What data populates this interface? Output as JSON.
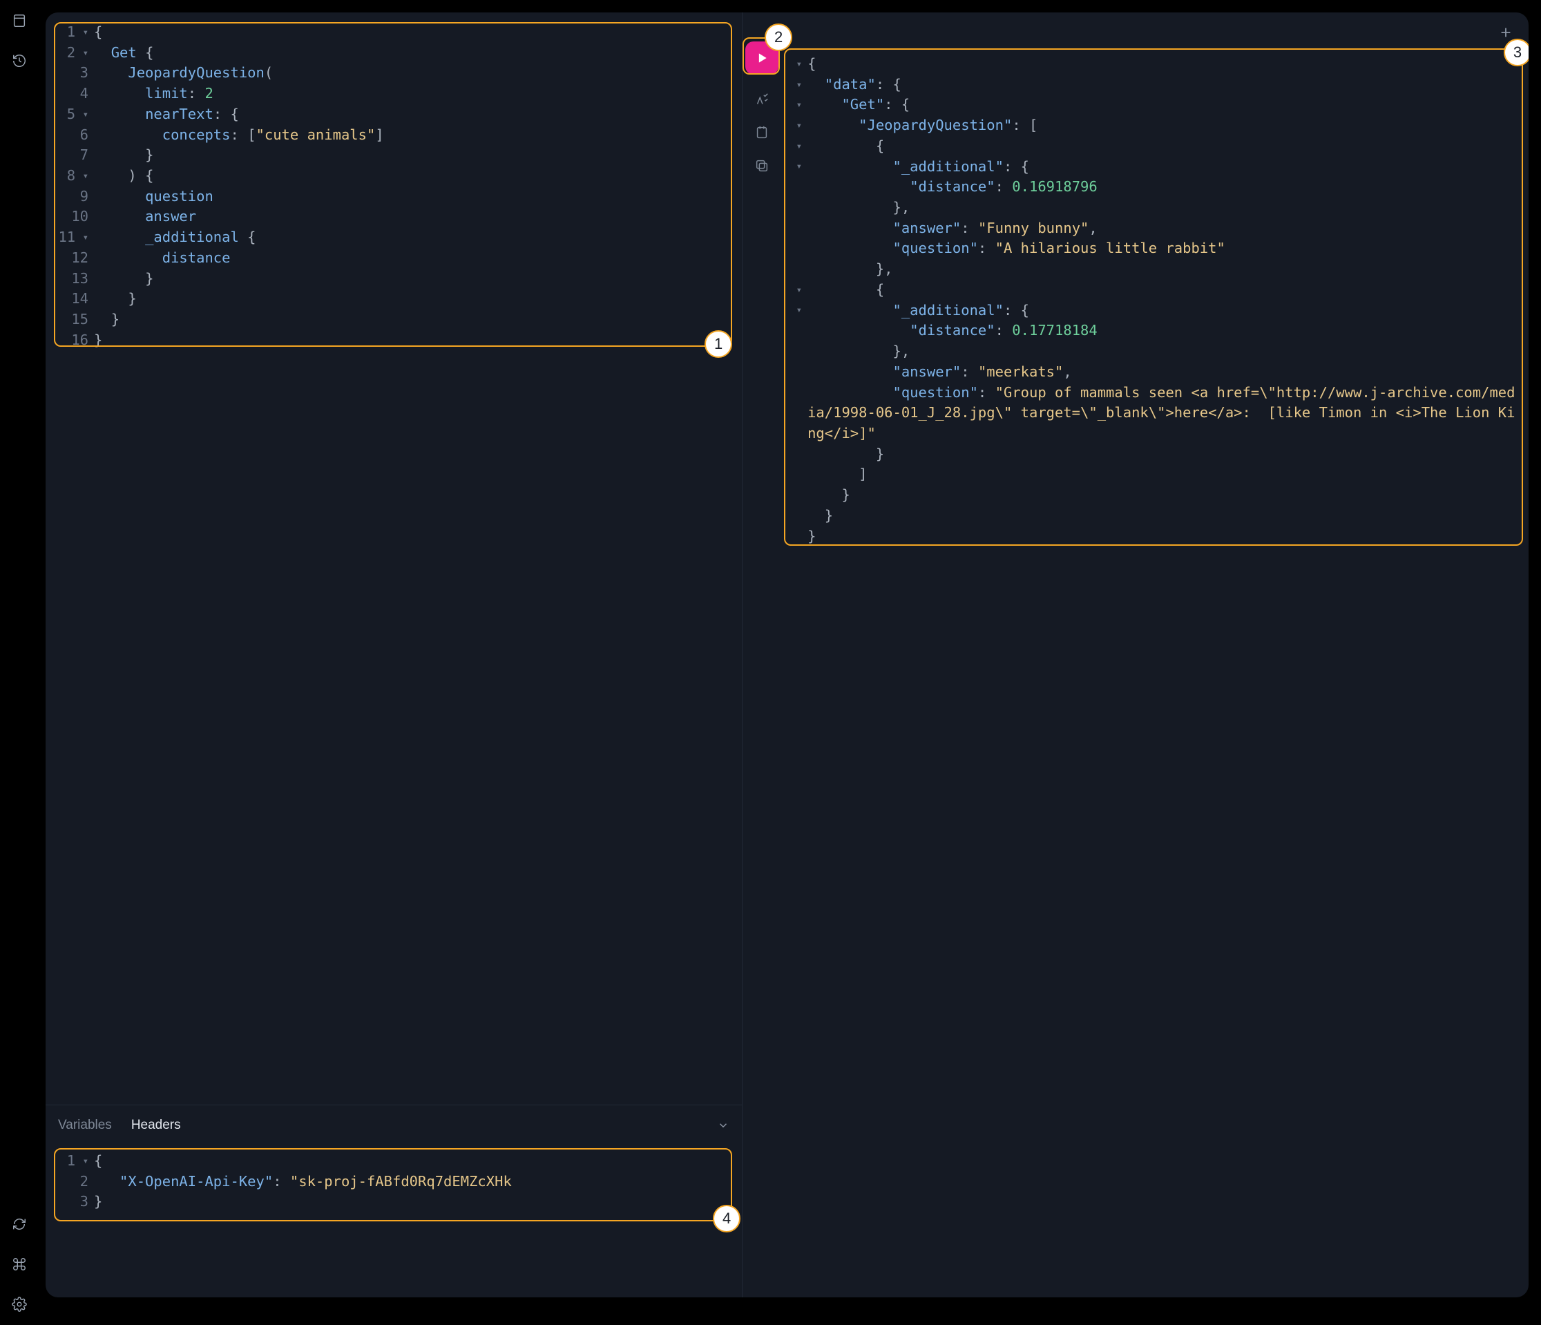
{
  "callouts": {
    "c1": "1",
    "c2": "2",
    "c3": "3",
    "c4": "4"
  },
  "tabs": {
    "variables": "Variables",
    "headers": "Headers",
    "active": "headers"
  },
  "query_lines": [
    {
      "n": "1",
      "fold": true,
      "segs": [
        [
          "punct",
          "{"
        ]
      ]
    },
    {
      "n": "2",
      "fold": true,
      "segs": [
        [
          "plain",
          "  "
        ],
        [
          "kw",
          "Get"
        ],
        [
          "plain",
          " "
        ],
        [
          "punct",
          "{"
        ]
      ]
    },
    {
      "n": "3",
      "fold": false,
      "segs": [
        [
          "plain",
          "    "
        ],
        [
          "kw",
          "JeopardyQuestion"
        ],
        [
          "punct",
          "("
        ]
      ]
    },
    {
      "n": "4",
      "fold": false,
      "segs": [
        [
          "plain",
          "      "
        ],
        [
          "prop",
          "limit"
        ],
        [
          "punct",
          ":"
        ],
        [
          "plain",
          " "
        ],
        [
          "num",
          "2"
        ]
      ]
    },
    {
      "n": "5",
      "fold": true,
      "segs": [
        [
          "plain",
          "      "
        ],
        [
          "prop",
          "nearText"
        ],
        [
          "punct",
          ":"
        ],
        [
          "plain",
          " "
        ],
        [
          "punct",
          "{"
        ]
      ]
    },
    {
      "n": "6",
      "fold": false,
      "segs": [
        [
          "plain",
          "        "
        ],
        [
          "prop",
          "concepts"
        ],
        [
          "punct",
          ":"
        ],
        [
          "plain",
          " "
        ],
        [
          "punct",
          "["
        ],
        [
          "str",
          "\"cute animals\""
        ],
        [
          "punct",
          "]"
        ]
      ]
    },
    {
      "n": "7",
      "fold": false,
      "segs": [
        [
          "plain",
          "      "
        ],
        [
          "punct",
          "}"
        ]
      ]
    },
    {
      "n": "8",
      "fold": true,
      "segs": [
        [
          "plain",
          "    "
        ],
        [
          "punct",
          ")"
        ],
        [
          "plain",
          " "
        ],
        [
          "punct",
          "{"
        ]
      ]
    },
    {
      "n": "9",
      "fold": false,
      "segs": [
        [
          "plain",
          "      "
        ],
        [
          "fld",
          "question"
        ]
      ]
    },
    {
      "n": "10",
      "fold": false,
      "segs": [
        [
          "plain",
          "      "
        ],
        [
          "fld",
          "answer"
        ]
      ]
    },
    {
      "n": "11",
      "fold": true,
      "segs": [
        [
          "plain",
          "      "
        ],
        [
          "fld",
          "_additional"
        ],
        [
          "plain",
          " "
        ],
        [
          "punct",
          "{"
        ]
      ]
    },
    {
      "n": "12",
      "fold": false,
      "segs": [
        [
          "plain",
          "        "
        ],
        [
          "fld",
          "distance"
        ]
      ]
    },
    {
      "n": "13",
      "fold": false,
      "segs": [
        [
          "plain",
          "      "
        ],
        [
          "punct",
          "}"
        ]
      ]
    },
    {
      "n": "14",
      "fold": false,
      "segs": [
        [
          "plain",
          "    "
        ],
        [
          "punct",
          "}"
        ]
      ]
    },
    {
      "n": "15",
      "fold": false,
      "segs": [
        [
          "plain",
          "  "
        ],
        [
          "punct",
          "}"
        ]
      ]
    },
    {
      "n": "16",
      "fold": false,
      "segs": [
        [
          "punct",
          "}"
        ]
      ]
    }
  ],
  "header_lines": [
    {
      "n": "1",
      "fold": true,
      "segs": [
        [
          "punct",
          "{"
        ]
      ]
    },
    {
      "n": "2",
      "fold": false,
      "segs": [
        [
          "plain",
          "   "
        ],
        [
          "key",
          "\"X-OpenAI-Api-Key\""
        ],
        [
          "punct",
          ":"
        ],
        [
          "plain",
          " "
        ],
        [
          "str",
          "\"sk-proj-fABfd0Rq7dEMZcXHk"
        ]
      ]
    },
    {
      "n": "3",
      "fold": false,
      "segs": [
        [
          "punct",
          "}"
        ]
      ]
    }
  ],
  "result_lines": [
    {
      "fold": true,
      "segs": [
        [
          "punct",
          "{"
        ]
      ]
    },
    {
      "fold": true,
      "segs": [
        [
          "plain",
          "  "
        ],
        [
          "key",
          "\"data\""
        ],
        [
          "punct",
          ": "
        ],
        [
          "punct",
          "{"
        ]
      ]
    },
    {
      "fold": true,
      "segs": [
        [
          "plain",
          "    "
        ],
        [
          "key",
          "\"Get\""
        ],
        [
          "punct",
          ": "
        ],
        [
          "punct",
          "{"
        ]
      ]
    },
    {
      "fold": true,
      "segs": [
        [
          "plain",
          "      "
        ],
        [
          "key",
          "\"JeopardyQuestion\""
        ],
        [
          "punct",
          ": "
        ],
        [
          "punct",
          "["
        ]
      ]
    },
    {
      "fold": true,
      "segs": [
        [
          "plain",
          "        "
        ],
        [
          "punct",
          "{"
        ]
      ]
    },
    {
      "fold": true,
      "segs": [
        [
          "plain",
          "          "
        ],
        [
          "key",
          "\"_additional\""
        ],
        [
          "punct",
          ": "
        ],
        [
          "punct",
          "{"
        ]
      ]
    },
    {
      "fold": false,
      "segs": [
        [
          "plain",
          "            "
        ],
        [
          "key",
          "\"distance\""
        ],
        [
          "punct",
          ": "
        ],
        [
          "num",
          "0.16918796"
        ]
      ]
    },
    {
      "fold": false,
      "segs": [
        [
          "plain",
          "          "
        ],
        [
          "punct",
          "},"
        ]
      ]
    },
    {
      "fold": false,
      "segs": [
        [
          "plain",
          "          "
        ],
        [
          "key",
          "\"answer\""
        ],
        [
          "punct",
          ": "
        ],
        [
          "str",
          "\"Funny bunny\""
        ],
        [
          "punct",
          ","
        ]
      ]
    },
    {
      "fold": false,
      "segs": [
        [
          "plain",
          "          "
        ],
        [
          "key",
          "\"question\""
        ],
        [
          "punct",
          ": "
        ],
        [
          "str",
          "\"A hilarious little rabbit\""
        ]
      ]
    },
    {
      "fold": false,
      "segs": [
        [
          "plain",
          "        "
        ],
        [
          "punct",
          "},"
        ]
      ]
    },
    {
      "fold": true,
      "segs": [
        [
          "plain",
          "        "
        ],
        [
          "punct",
          "{"
        ]
      ]
    },
    {
      "fold": true,
      "segs": [
        [
          "plain",
          "          "
        ],
        [
          "key",
          "\"_additional\""
        ],
        [
          "punct",
          ": "
        ],
        [
          "punct",
          "{"
        ]
      ]
    },
    {
      "fold": false,
      "segs": [
        [
          "plain",
          "            "
        ],
        [
          "key",
          "\"distance\""
        ],
        [
          "punct",
          ": "
        ],
        [
          "num",
          "0.17718184"
        ]
      ]
    },
    {
      "fold": false,
      "segs": [
        [
          "plain",
          "          "
        ],
        [
          "punct",
          "},"
        ]
      ]
    },
    {
      "fold": false,
      "segs": [
        [
          "plain",
          "          "
        ],
        [
          "key",
          "\"answer\""
        ],
        [
          "punct",
          ": "
        ],
        [
          "str",
          "\"meerkats\""
        ],
        [
          "punct",
          ","
        ]
      ]
    },
    {
      "fold": false,
      "segs": [
        [
          "plain",
          "          "
        ],
        [
          "key",
          "\"question\""
        ],
        [
          "punct",
          ": "
        ],
        [
          "str",
          "\"Group of mammals seen <a href=\\\"http://www.j-archive.com/media/1998-06-01_J_28.jpg\\\" target=\\\"_blank\\\">here</a>:  [like Timon in <i>The Lion King</i>]\""
        ]
      ]
    },
    {
      "fold": false,
      "segs": [
        [
          "plain",
          "        "
        ],
        [
          "punct",
          "}"
        ]
      ]
    },
    {
      "fold": false,
      "segs": [
        [
          "plain",
          "      "
        ],
        [
          "punct",
          "]"
        ]
      ]
    },
    {
      "fold": false,
      "segs": [
        [
          "plain",
          "    "
        ],
        [
          "punct",
          "}"
        ]
      ]
    },
    {
      "fold": false,
      "segs": [
        [
          "plain",
          "  "
        ],
        [
          "punct",
          "}"
        ]
      ]
    },
    {
      "fold": false,
      "segs": [
        [
          "punct",
          "}"
        ]
      ]
    }
  ]
}
